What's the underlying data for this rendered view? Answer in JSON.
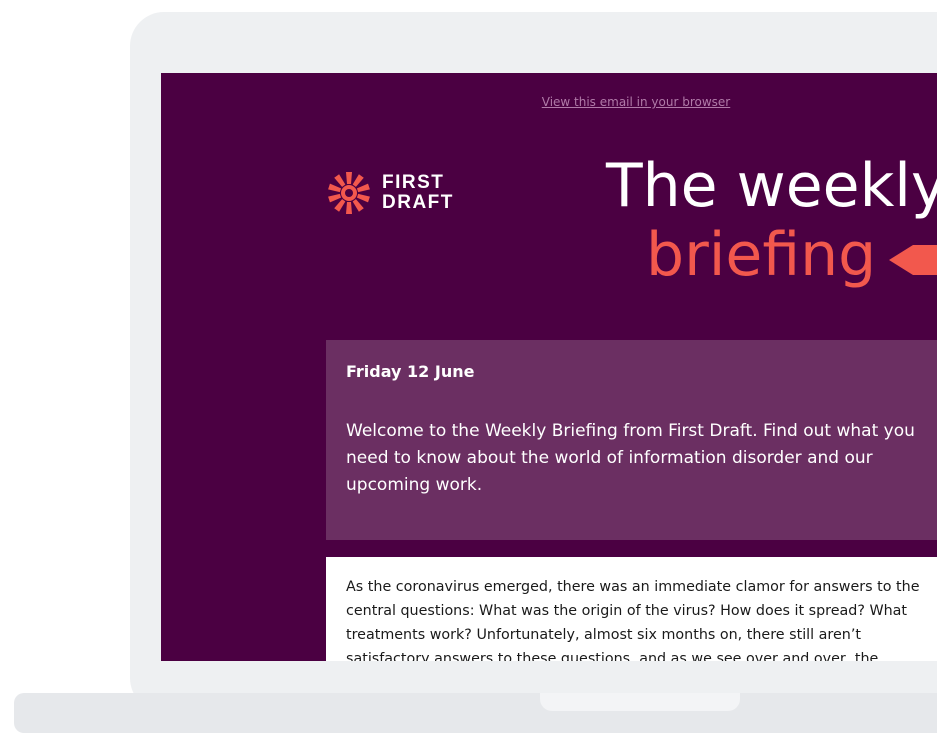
{
  "email": {
    "browser_link": "View this email in your browser",
    "logo": {
      "line1": "FIRST",
      "line2": "DRAFT"
    },
    "header": {
      "title_line1": "The weekly",
      "title_line2": "briefing"
    },
    "intro": {
      "date": "Friday 12 June",
      "welcome": "Welcome to the Weekly Briefing from First Draft. Find out what you need to know about the world of information disorder and our upcoming work."
    },
    "article": {
      "body": "As the coronavirus emerged, there was an immediate clamor for answers to the central questions: What was the origin of the virus? How does it spread? What treatments work? Unfortunately, almost six months on, there still aren’t satisfactory answers to these questions, and as we see over and over, the"
    }
  },
  "colors": {
    "background": "#4b0042",
    "intro_box": "#6b2f62",
    "accent": "#f2584d",
    "link": "#b07aa8",
    "laptop_frame": "#eef0f2"
  },
  "icons": {
    "logo": "starburst-logo-icon",
    "arrow": "arrow-left-icon"
  }
}
